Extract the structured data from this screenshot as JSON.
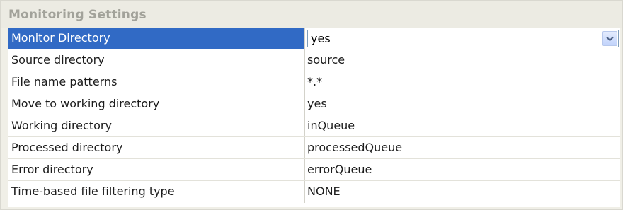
{
  "section": {
    "title": "Monitoring Settings"
  },
  "properties": [
    {
      "name": "Monitor Directory",
      "value": "yes"
    },
    {
      "name": "Source directory",
      "value": "source"
    },
    {
      "name": "File name patterns",
      "value": "*.*"
    },
    {
      "name": "Move to working directory",
      "value": "yes"
    },
    {
      "name": "Working directory",
      "value": "inQueue"
    },
    {
      "name": "Processed directory",
      "value": "processedQueue"
    },
    {
      "name": "Error directory",
      "value": "errorQueue"
    },
    {
      "name": "Time-based file filtering type",
      "value": "NONE"
    }
  ],
  "combo": {
    "icon": "chevron-down-icon"
  },
  "colors": {
    "selection": "#316ac5",
    "section_title": "#a2a29a",
    "panel_background": "#f0efe7"
  }
}
